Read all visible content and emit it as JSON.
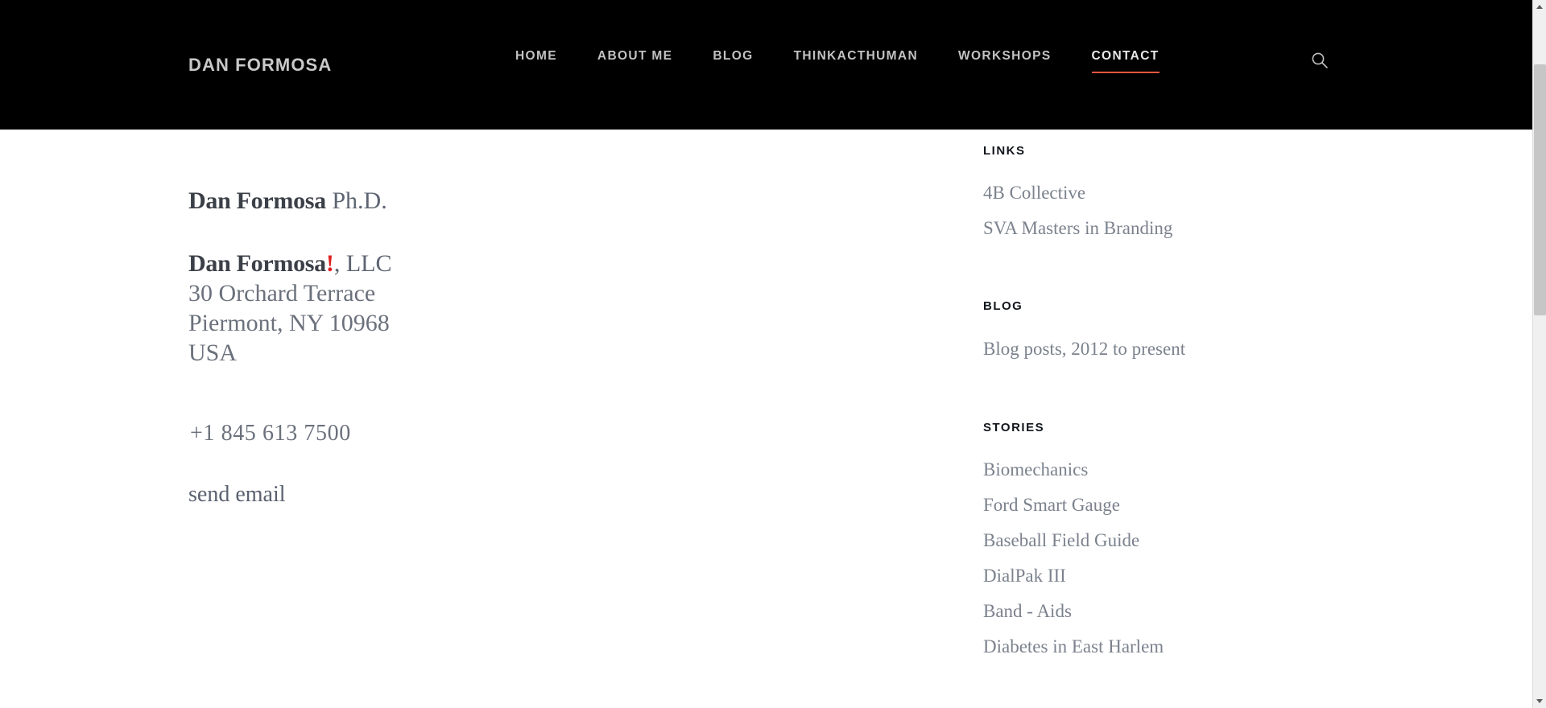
{
  "header": {
    "brand": "DAN FORMOSA",
    "nav": [
      {
        "label": "HOME",
        "active": false
      },
      {
        "label": "ABOUT ME",
        "active": false
      },
      {
        "label": "BLOG",
        "active": false
      },
      {
        "label": "THINKACTHUMAN",
        "active": false
      },
      {
        "label": "WORKSHOPS",
        "active": false
      },
      {
        "label": "CONTACT",
        "active": true
      }
    ],
    "search_icon": "search-icon",
    "background_color": "#000000",
    "active_underline_color": "#e8573f",
    "nav_text_color": "#c2c2c2"
  },
  "contact": {
    "name": "Dan Formosa",
    "credential": "Ph.D.",
    "company_name": "Dan Formosa",
    "company_bang": "!",
    "company_suffix": ", LLC",
    "address_line1": "30 Orchard Terrace",
    "address_line2": "Piermont, NY 10968",
    "address_line3": "USA",
    "phone": "+1 845 613 7500",
    "email_label": "send email",
    "accent_color": "#e02020"
  },
  "sidebar": {
    "sections": [
      {
        "heading": "LINKS",
        "links": [
          "4B Collective",
          "SVA Masters in Branding"
        ]
      },
      {
        "heading": "BLOG",
        "links": [
          "Blog posts, 2012 to present"
        ]
      },
      {
        "heading": "STORIES",
        "links": [
          "Biomechanics",
          "Ford Smart Gauge",
          "Baseball Field Guide",
          "DialPak III",
          "Band - Aids",
          "Diabetes in East Harlem"
        ]
      }
    ]
  },
  "scrollbar": {
    "up_icon": "chevron-up-icon",
    "down_icon": "chevron-down-icon",
    "thumb": "scrollbar-thumb"
  }
}
